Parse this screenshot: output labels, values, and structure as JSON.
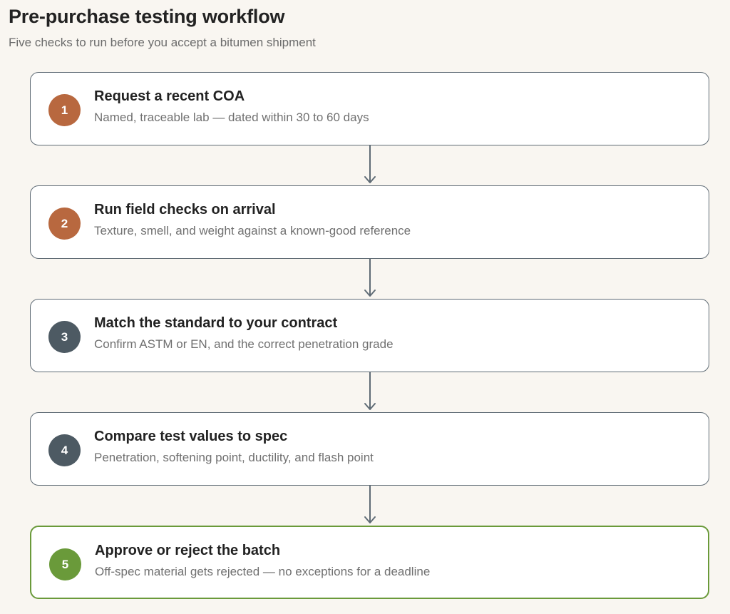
{
  "header": {
    "title": "Pre-purchase testing workflow",
    "subtitle": "Five checks to run before you accept a bitumen shipment"
  },
  "colors": {
    "badge_orange": "#b8683f",
    "badge_slate": "#4d5a63",
    "badge_green": "#6a9a3a",
    "border_default": "#5f6b75",
    "border_final": "#6a9a3a",
    "connector": "#5f6b75"
  },
  "steps": [
    {
      "number": "1",
      "title": "Request a recent COA",
      "description": "Named, traceable lab — dated within 30 to 60 days",
      "badge_color": "#b8683f"
    },
    {
      "number": "2",
      "title": "Run field checks on arrival",
      "description": "Texture, smell, and weight against a known-good reference",
      "badge_color": "#b8683f"
    },
    {
      "number": "3",
      "title": "Match the standard to your contract",
      "description": "Confirm ASTM or EN, and the correct penetration grade",
      "badge_color": "#4d5a63"
    },
    {
      "number": "4",
      "title": "Compare test values to spec",
      "description": "Penetration, softening point, ductility, and flash point",
      "badge_color": "#4d5a63"
    },
    {
      "number": "5",
      "title": "Approve or reject the batch",
      "description": "Off-spec material gets rejected — no exceptions for a deadline",
      "badge_color": "#6a9a3a"
    }
  ]
}
